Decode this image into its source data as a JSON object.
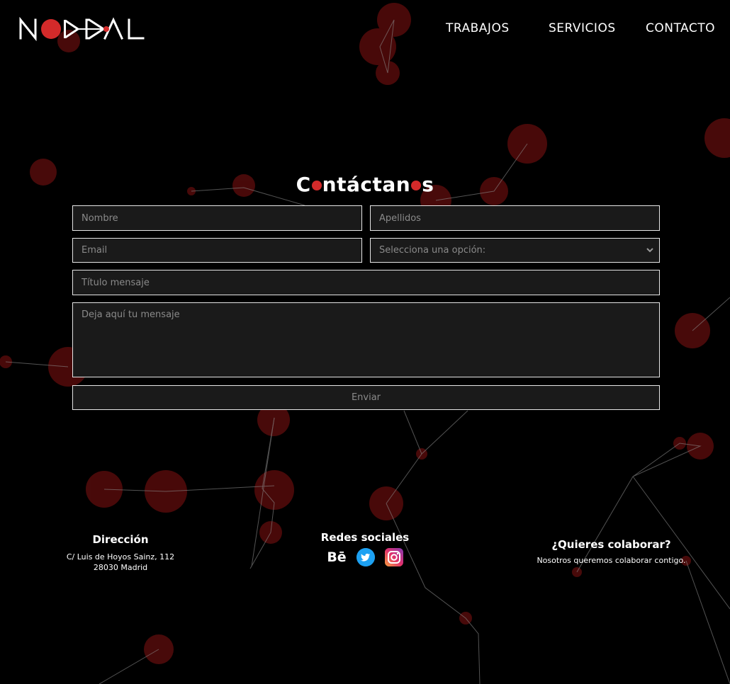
{
  "brand": {
    "logo_text": "NODAL",
    "accent": "#d42a2a"
  },
  "nav": {
    "items": [
      "TRABAJOS",
      "SERVICIOS",
      "CONTACTO"
    ]
  },
  "contact": {
    "title": {
      "p1": "C",
      "p2": "ntáctan",
      "p3": "s"
    },
    "fields": {
      "nombre": "Nombre",
      "apellidos": "Apellidos",
      "email": "Email",
      "select": "Selecciona una opción:",
      "titulo": "Título mensaje",
      "mensaje": "Deja aquí tu mensaje"
    },
    "submit": "Enviar"
  },
  "footer": {
    "address": {
      "heading": "Dirección",
      "line1": "C/ Luis de Hoyos Sainz, 112",
      "line2": "28030 Madrid"
    },
    "social": {
      "heading": "Redes sociales",
      "icons": [
        "behance-icon",
        "twitter-icon",
        "instagram-icon"
      ],
      "behance_glyph": "Bē"
    },
    "collab": {
      "heading": "¿Quieres colaborar?",
      "text": "Nosotros queremos colaborar contigo."
    }
  }
}
